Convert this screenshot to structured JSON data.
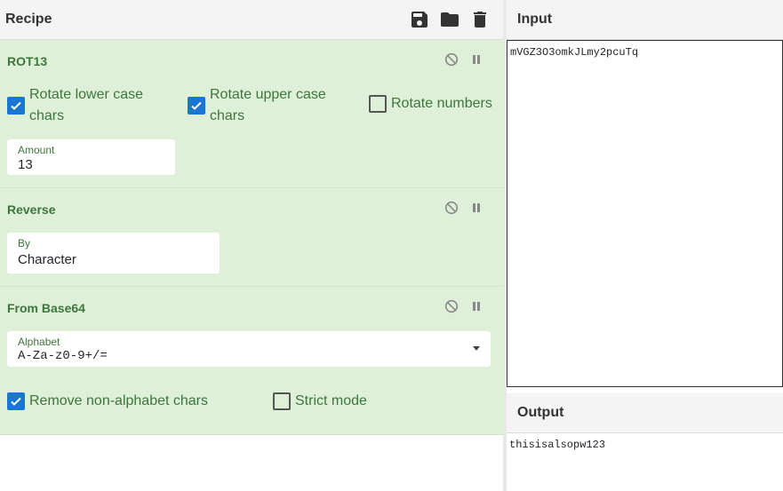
{
  "recipe": {
    "title": "Recipe",
    "icons": [
      "save-icon",
      "folder-icon",
      "trash-icon"
    ]
  },
  "operations": [
    {
      "name": "ROT13",
      "checkboxes": [
        {
          "label": "Rotate lower case chars",
          "line1": "Rotate lower case",
          "line2": "chars",
          "checked": true
        },
        {
          "label": "Rotate upper case chars",
          "line1": "Rotate upper case",
          "line2": "chars",
          "checked": true
        },
        {
          "label": "Rotate numbers",
          "checked": false
        }
      ],
      "amount_label": "Amount",
      "amount_value": "13"
    },
    {
      "name": "Reverse",
      "by_label": "By",
      "by_value": "Character"
    },
    {
      "name": "From Base64",
      "alphabet_label": "Alphabet",
      "alphabet_value": "A-Za-z0-9+/=",
      "checkboxes": [
        {
          "label": "Remove non-alphabet chars",
          "checked": true
        },
        {
          "label": "Strict mode",
          "checked": false
        }
      ]
    }
  ],
  "input": {
    "title": "Input",
    "value": "mVGZ3O3omkJLmy2pcuTq"
  },
  "output": {
    "title": "Output",
    "value": "thisisalsopw123"
  },
  "colors": {
    "op_bg": "#dff0d8",
    "op_text": "#3c763d",
    "checkbox_on": "#1976d2"
  }
}
